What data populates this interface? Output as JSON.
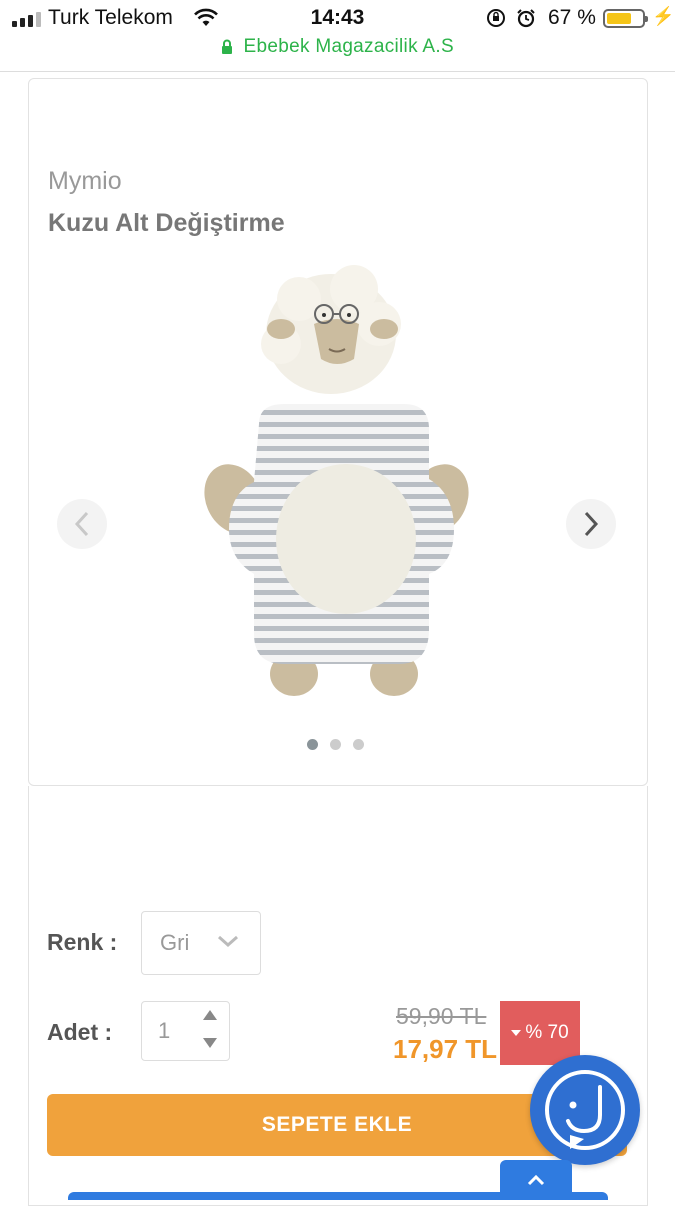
{
  "status_bar": {
    "carrier": "Turk Telekom",
    "time": "14:43",
    "battery_percent": "67 %",
    "battery_level": 0.67,
    "icons": [
      "signal-icon",
      "wifi-icon",
      "rotation-lock-icon",
      "alarm-icon",
      "battery-icon",
      "charging-icon"
    ]
  },
  "url_bar": {
    "site": "Ebebek Magazacilik A.S",
    "secure": true
  },
  "product": {
    "brand": "Mymio",
    "name": "Kuzu Alt Değiştirme",
    "image_count": 3,
    "active_image": 1
  },
  "options": {
    "color_label": "Renk :",
    "color_value": "Gri",
    "quantity_label": "Adet :",
    "quantity_value": "1"
  },
  "pricing": {
    "old_price": "59,90 TL",
    "new_price": "17,97 TL",
    "discount": "% 70"
  },
  "actions": {
    "add_to_cart": "SEPETE EKLE"
  },
  "colors": {
    "accent_orange": "#f0a23c",
    "price_orange": "#f0962a",
    "discount_red": "#e15d5d",
    "chat_blue": "#2f6fd1",
    "secure_green": "#2db34a"
  }
}
